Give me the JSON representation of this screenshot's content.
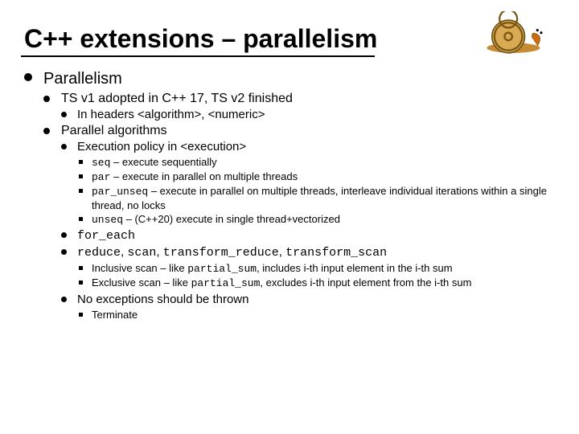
{
  "title": "C++ extensions – parallelism",
  "l1": {
    "text": "Parallelism"
  },
  "l2a": {
    "text": "TS v1 adopted in C++ 17, TS v2 finished"
  },
  "l3a": {
    "text": "In headers <algorithm>, <numeric>"
  },
  "l2b": {
    "text": "Parallel algorithms"
  },
  "l3b": {
    "text": "Execution policy in <execution>"
  },
  "policies": {
    "seq": {
      "code": "seq",
      "desc": " – execute sequentially"
    },
    "par": {
      "code": "par",
      "desc": " – execute in parallel on multiple threads"
    },
    "pun": {
      "code": "par_unseq",
      "desc": " – execute in parallel on multiple threads, interleave individual iterations within a single thread, no locks"
    },
    "uns": {
      "code": "unseq",
      "desc": " – (C++20) execute in single thread+vectorized"
    }
  },
  "algs": {
    "foreach": {
      "code": "for_each"
    },
    "list": {
      "c1": "reduce",
      "s1": ", ",
      "c2": "scan",
      "s2": ", ",
      "c3": "transform_reduce",
      "s3": ", ",
      "c4": "transform_scan"
    }
  },
  "scans": {
    "inc": {
      "pre": "Inclusive scan – like ",
      "code": "partial_sum",
      "post": ", includes i-th input element in the i-th sum"
    },
    "exc": {
      "pre": "Exclusive scan – like ",
      "code": "partial_sum",
      "post": ", excludes i-th input element from the i-th sum"
    }
  },
  "noexc": {
    "text": "No exceptions should be thrown"
  },
  "term": {
    "text": "Terminate"
  }
}
